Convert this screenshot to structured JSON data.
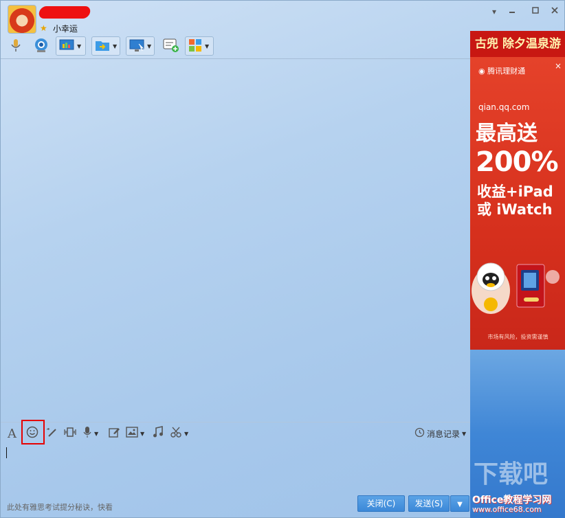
{
  "window": {
    "nickname": "小幸运",
    "controls": [
      "minimize-dropdown",
      "minimize",
      "maximize",
      "close"
    ]
  },
  "toolbar": {
    "icons": [
      "microphone-icon",
      "camera-icon",
      "screen-share-icon",
      "file-transfer-icon",
      "remote-desktop-icon",
      "new-chat-icon",
      "apps-grid-icon"
    ]
  },
  "ad": {
    "top_banner": "古兜 除夕温泉游",
    "logo_text": "腾讯理财通",
    "close": "×",
    "url": "qian.qq.com",
    "headline1": "最高送",
    "headline2": "200%",
    "headline3": "收益+iPad",
    "headline4": "或 iWatch",
    "footnote": "市场有风险，投资需谨慎"
  },
  "input_toolbar": {
    "font": "A",
    "history_label": "消息记录"
  },
  "bottom": {
    "tip": "此处有雅思考试提分秘诀，快看",
    "close_label": "关闭(C)",
    "send_label": "发送(S)"
  },
  "watermark": {
    "line1": "下载吧",
    "line2": "Office教程学习网",
    "line3": "www.office68.com"
  },
  "colors": {
    "accent": "#3c88d8",
    "highlight": "#e60000",
    "ad_red": "#d7341f"
  }
}
